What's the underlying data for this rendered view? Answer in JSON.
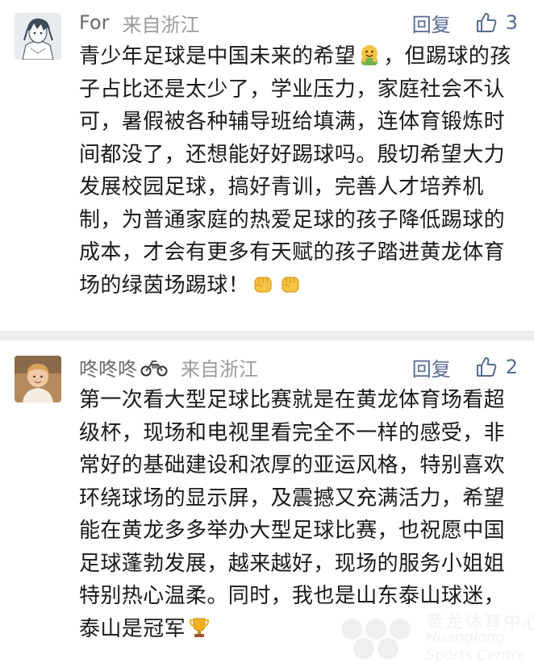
{
  "comments": [
    {
      "avatar": "anime-character-avatar",
      "nickname": "For",
      "location": "来自浙江",
      "reply_label": "回复",
      "like_count": "3",
      "text_segments": {
        "part1": "青少年足球是中国未来的希望",
        "emoji1": "hugging-face-emoji",
        "part2": "，但踢球的孩子占比还是太少了，学业压力，家庭社会不认可，暑假被各种辅导班给填满，连体育锻炼时间都没了，还想能好好踢球吗。殷切希望大力发展校园足球，搞好青训，完善人才培养机制，为普通家庭的热爱足球的孩子降低踢球的成本，才会有更多有天赋的孩子踏进黄龙体育场的绿茵场踢球！",
        "emoji2": "fist-emoji",
        "emoji3": "fist-emoji"
      }
    },
    {
      "avatar": "child-photo-avatar",
      "nickname": "咚咚咚",
      "nickname_icon": "motorcycle-emoji",
      "location": "来自浙江",
      "reply_label": "回复",
      "like_count": "2",
      "text_segments": {
        "part1": "第一次看大型足球比赛就是在黄龙体育场看超级杯，现场和电视里看完全不一样的感受，非常好的基础建设和浓厚的亚运风格，特别喜欢环绕球场的显示屏，及震撼又充满活力，希望能在黄龙多多举办大型足球比赛，也祝愿中国足球蓬勃发展，越来越好，现场的服务小姐姐特别热心温柔。同时，我也是山东泰山球迷，泰山是冠军",
        "emoji1": "trophy-emoji"
      }
    }
  ],
  "watermark": {
    "chinese": "黄龙体育中心",
    "english_line1": "Huanglong",
    "english_line2": "Sports Centre"
  },
  "colors": {
    "link": "#576b95",
    "text": "#1a1a1a",
    "nickname": "#6b6b6b",
    "location": "#9b9b9b",
    "separator": "#ededed"
  }
}
